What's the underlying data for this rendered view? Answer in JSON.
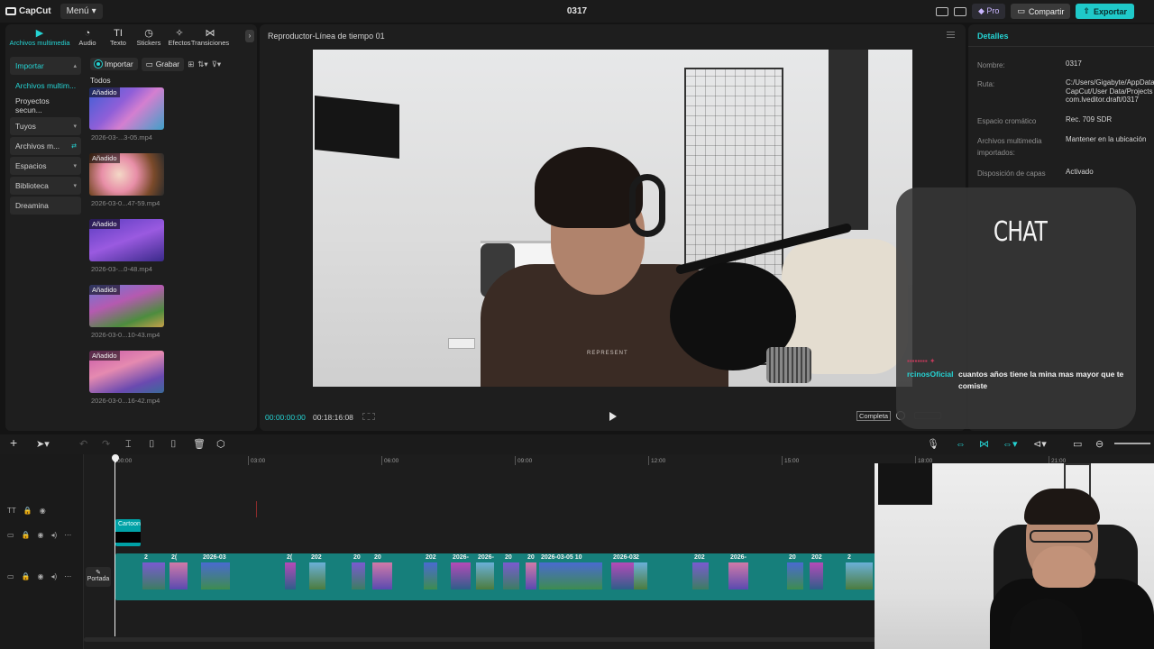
{
  "app": {
    "logo_text": "CapCut",
    "menu_label": "Menú",
    "project_name": "0317",
    "pro_label": "Pro",
    "share_label": "Compartir",
    "export_label": "Exportar",
    "accent_color": "#25d3d3"
  },
  "media_panel": {
    "tabs": [
      {
        "label": "Archivos multimedia",
        "icon": "media-icon"
      },
      {
        "label": "Audio",
        "icon": "audio-icon"
      },
      {
        "label": "Texto",
        "icon": "text-icon"
      },
      {
        "label": "Stickers",
        "icon": "sticker-icon"
      },
      {
        "label": "Efectos",
        "icon": "effects-icon"
      },
      {
        "label": "Transiciones",
        "icon": "transitions-icon"
      }
    ],
    "nav": [
      {
        "label": "Importar"
      },
      {
        "label": "Archivos multim..."
      },
      {
        "label": "Proyectos secun..."
      },
      {
        "label": "Tuyos"
      },
      {
        "label": "Archivos m..."
      },
      {
        "label": "Espacios"
      },
      {
        "label": "Biblioteca"
      },
      {
        "label": "Dreamina"
      }
    ],
    "toolbar": {
      "import_label": "Importar",
      "record_label": "Grabar"
    },
    "section_label": "Todos",
    "items": [
      {
        "tag": "Añadido",
        "name": "2026-03-...3-05.mp4"
      },
      {
        "tag": "Añadido",
        "name": "2026-03-0...47-59.mp4"
      },
      {
        "tag": "Añadido",
        "name": "2026-03-...0-48.mp4"
      },
      {
        "tag": "Añadido",
        "name": "2026-03-0...10-43.mp4"
      },
      {
        "tag": "Añadido",
        "name": "2026-03-0...16-42.mp4"
      }
    ]
  },
  "player": {
    "title": "Reproductor-Línea de tiempo 01",
    "current_time": "00:00:00:00",
    "total_time": "00:18:16:08",
    "ratio_label": "Completa",
    "video_shirt_text": "REPRESENT"
  },
  "details": {
    "title": "Detalles",
    "rows": [
      {
        "key": "Nombre:",
        "value": "0317"
      },
      {
        "key": "Ruta:",
        "value": "C:/Users/Gigabyte/AppData\nCapCut/User Data/Projects\ncom.lveditor.draft/0317"
      },
      {
        "key": "Espacio cromático",
        "value": "Rec. 709 SDR"
      },
      {
        "key": "Archivos multimedia importados:",
        "value": "Mantener en la ubicación"
      },
      {
        "key": "Disposición de capas",
        "value": "Activado"
      }
    ]
  },
  "chat": {
    "title": "CHAT",
    "username": "rcinosOficial",
    "message": "cuantos años tiene la mina mas mayor que te comiste"
  },
  "timeline": {
    "ruler_ticks": [
      "00:00",
      "03:00",
      "06:00",
      "09:00",
      "12:00",
      "15:00",
      "18:00",
      "21:00"
    ],
    "text_clip_label": "Cartoon",
    "cover_label": "Portada",
    "clip_labels": [
      "2",
      "2(",
      "2026-03",
      "2(",
      "202",
      "20",
      "20",
      "202",
      "2026-",
      "2026-",
      "20",
      "20",
      "2026-03-05 10",
      "2026-03",
      "2",
      "202",
      "2026-",
      "20",
      "202",
      "2"
    ]
  }
}
